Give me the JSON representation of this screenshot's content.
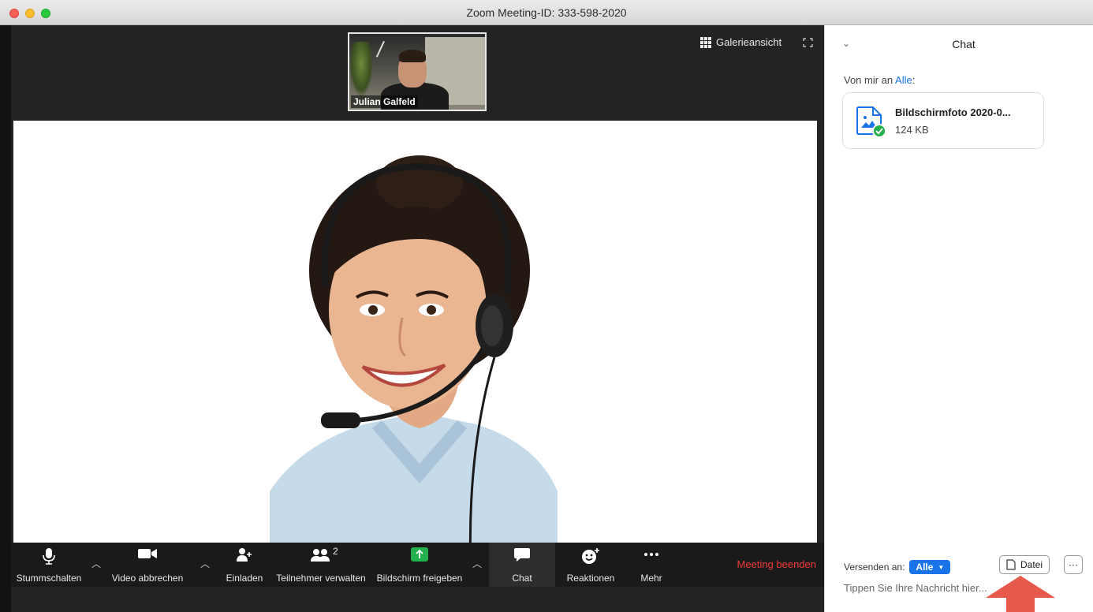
{
  "window": {
    "title": "Zoom Meeting-ID: 333-598-2020"
  },
  "meeting": {
    "thumbnail_name": "Julian Galfeld",
    "gallery_label": "Galerieansicht"
  },
  "toolbar": {
    "mute_label": "Stummschalten",
    "video_label": "Video abbrechen",
    "invite_label": "Einladen",
    "participants_label": "Teilnehmer verwalten",
    "participants_count": "2",
    "share_label": "Bildschirm freigeben",
    "chat_label": "Chat",
    "reactions_label": "Reaktionen",
    "more_label": "Mehr",
    "end_label": "Meeting beenden"
  },
  "chat": {
    "title": "Chat",
    "from_text": "Von mir an ",
    "from_recipient": "Alle",
    "from_suffix": ":",
    "file_name": "Bildschirmfoto 2020-0...",
    "file_size": "124 KB",
    "send_to_label": "Versenden an:",
    "send_to_value": "Alle",
    "file_button": "Datei",
    "input_placeholder": "Tippen Sie Ihre Nachricht hier..."
  },
  "colors": {
    "accent": "#1a73e8",
    "end_meeting": "#ef3b3b",
    "share_green": "#22b14c",
    "arrow": "#e65a4c"
  }
}
